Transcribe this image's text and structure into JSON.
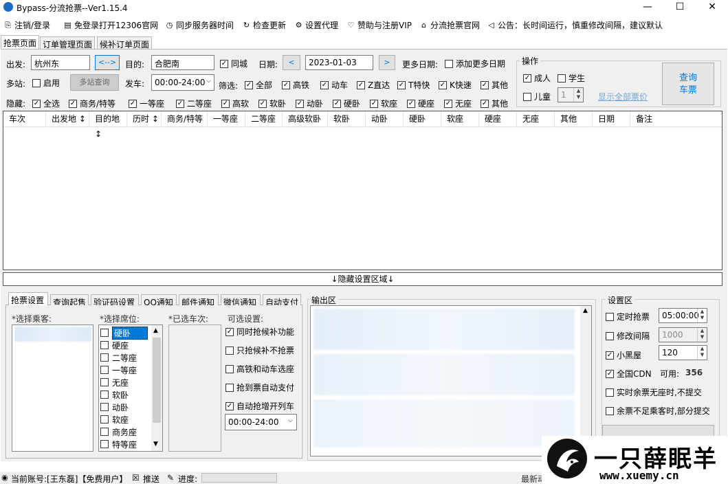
{
  "window": {
    "title": "Bypass-分流抢票--Ver1.15.4",
    "minimize": "—",
    "maximize": "☐",
    "close": "✕"
  },
  "menu": [
    {
      "icon": "logout-icon",
      "label": "注销/登录"
    },
    {
      "icon": "browser-icon",
      "label": "免登录打开12306官网"
    },
    {
      "icon": "clock-icon",
      "label": "同步服务器时间"
    },
    {
      "icon": "refresh-icon",
      "label": "检查更新"
    },
    {
      "icon": "gear-icon",
      "label": "设置代理"
    },
    {
      "icon": "heart-icon",
      "label": "赞助与注册VIP"
    },
    {
      "icon": "home-icon",
      "label": "分流抢票官网"
    },
    {
      "icon": "speaker-icon",
      "label": "公告：长时间运行，慎重修改间隔，建议默认"
    }
  ],
  "tabs": [
    "抢票页面",
    "订单管理页面",
    "候补订单页面"
  ],
  "query": {
    "from_label": "出发:",
    "from_value": "杭州东",
    "swap_label": "<-->",
    "to_label": "目的:",
    "to_value": "合肥南",
    "same_city": "同城",
    "date_label": "日期:",
    "date_value": "2023-01-03",
    "prev": "<",
    "next": ">",
    "more_dates_label": "更多日期:",
    "add_more_dates": "添加更多日期",
    "multi_label": "多站:",
    "multi_enable": "启用",
    "multi_query_btn": "多站查询",
    "depart_label": "发车:",
    "depart_value": "00:00-24:00",
    "filter_label": "筛选:",
    "filters": [
      "全部",
      "高铁",
      "动车",
      "Z直达",
      "T特快",
      "K快速",
      "其他"
    ],
    "hide_label": "隐藏:",
    "hides": [
      "全选",
      "商务/特等",
      "一等座",
      "二等座",
      "高软",
      "软卧",
      "动卧",
      "硬卧",
      "软座",
      "硬座",
      "无座",
      "其他"
    ]
  },
  "operation": {
    "title": "操作",
    "adult": "成人",
    "student": "学生",
    "child": "儿童",
    "child_count": "1",
    "show_all_price": "显示全部票价",
    "query_btn_line1": "查询",
    "query_btn_line2": "车票"
  },
  "grid_columns": [
    "车次",
    "出发地 ↕",
    "目的地 ↕",
    "历时 ↕",
    "商务/特等",
    "一等座",
    "二等座",
    "高级软卧",
    "软卧",
    "动卧",
    "硬卧",
    "软座",
    "硬座",
    "无座",
    "其他",
    "日期",
    "备注"
  ],
  "hide_settings_bar": "↓隐藏设置区域↓",
  "subtabs": [
    "抢票设置",
    "查询起售",
    "验证码设置",
    "QQ通知",
    "邮件通知",
    "微信通知",
    "自动支付"
  ],
  "booking": {
    "passenger_label": "*选择乘客:",
    "seat_label": "*选择席位:",
    "seats": [
      "硬卧",
      "硬座",
      "二等座",
      "一等座",
      "无座",
      "软卧",
      "动卧",
      "软座",
      "商务座",
      "特等座"
    ],
    "selected_train_label": "*已选车次:",
    "options_label": "可选设置:",
    "options": [
      {
        "label": "同时抢候补功能",
        "checked": true
      },
      {
        "label": "只抢候补不抢票",
        "checked": false
      },
      {
        "label": "高铁和动车选座",
        "checked": false
      },
      {
        "label": "抢到票自动支付",
        "checked": false
      },
      {
        "label": "自动抢增开列车",
        "checked": true
      }
    ],
    "time_range": "00:00-24:00"
  },
  "output": {
    "title": "输出区"
  },
  "settings": {
    "title": "设置区",
    "timed": "定时抢票",
    "timed_value": "05:00:00",
    "interval": "修改间隔",
    "interval_value": "1000",
    "blackroom": "小黑屋",
    "blackroom_value": "120",
    "cdn": "全国CDN",
    "cdn_available_label": "可用:",
    "cdn_available_value": "356",
    "no_seat_opt": "实时余票无座时,不提交",
    "partial_opt": "余票不足乘客时,部分提交"
  },
  "status": {
    "account": "当前账号:[王东磊]【免费用户】",
    "push": "推送",
    "progress": "进度:",
    "latest": "最新动"
  },
  "watermark": {
    "text1": "一只薛眠羊",
    "text2": "www.xuemy.cn"
  },
  "colors": {
    "accent": "#0078d7",
    "link": "#0066cc",
    "brand_icon": "#1b6ec2"
  }
}
